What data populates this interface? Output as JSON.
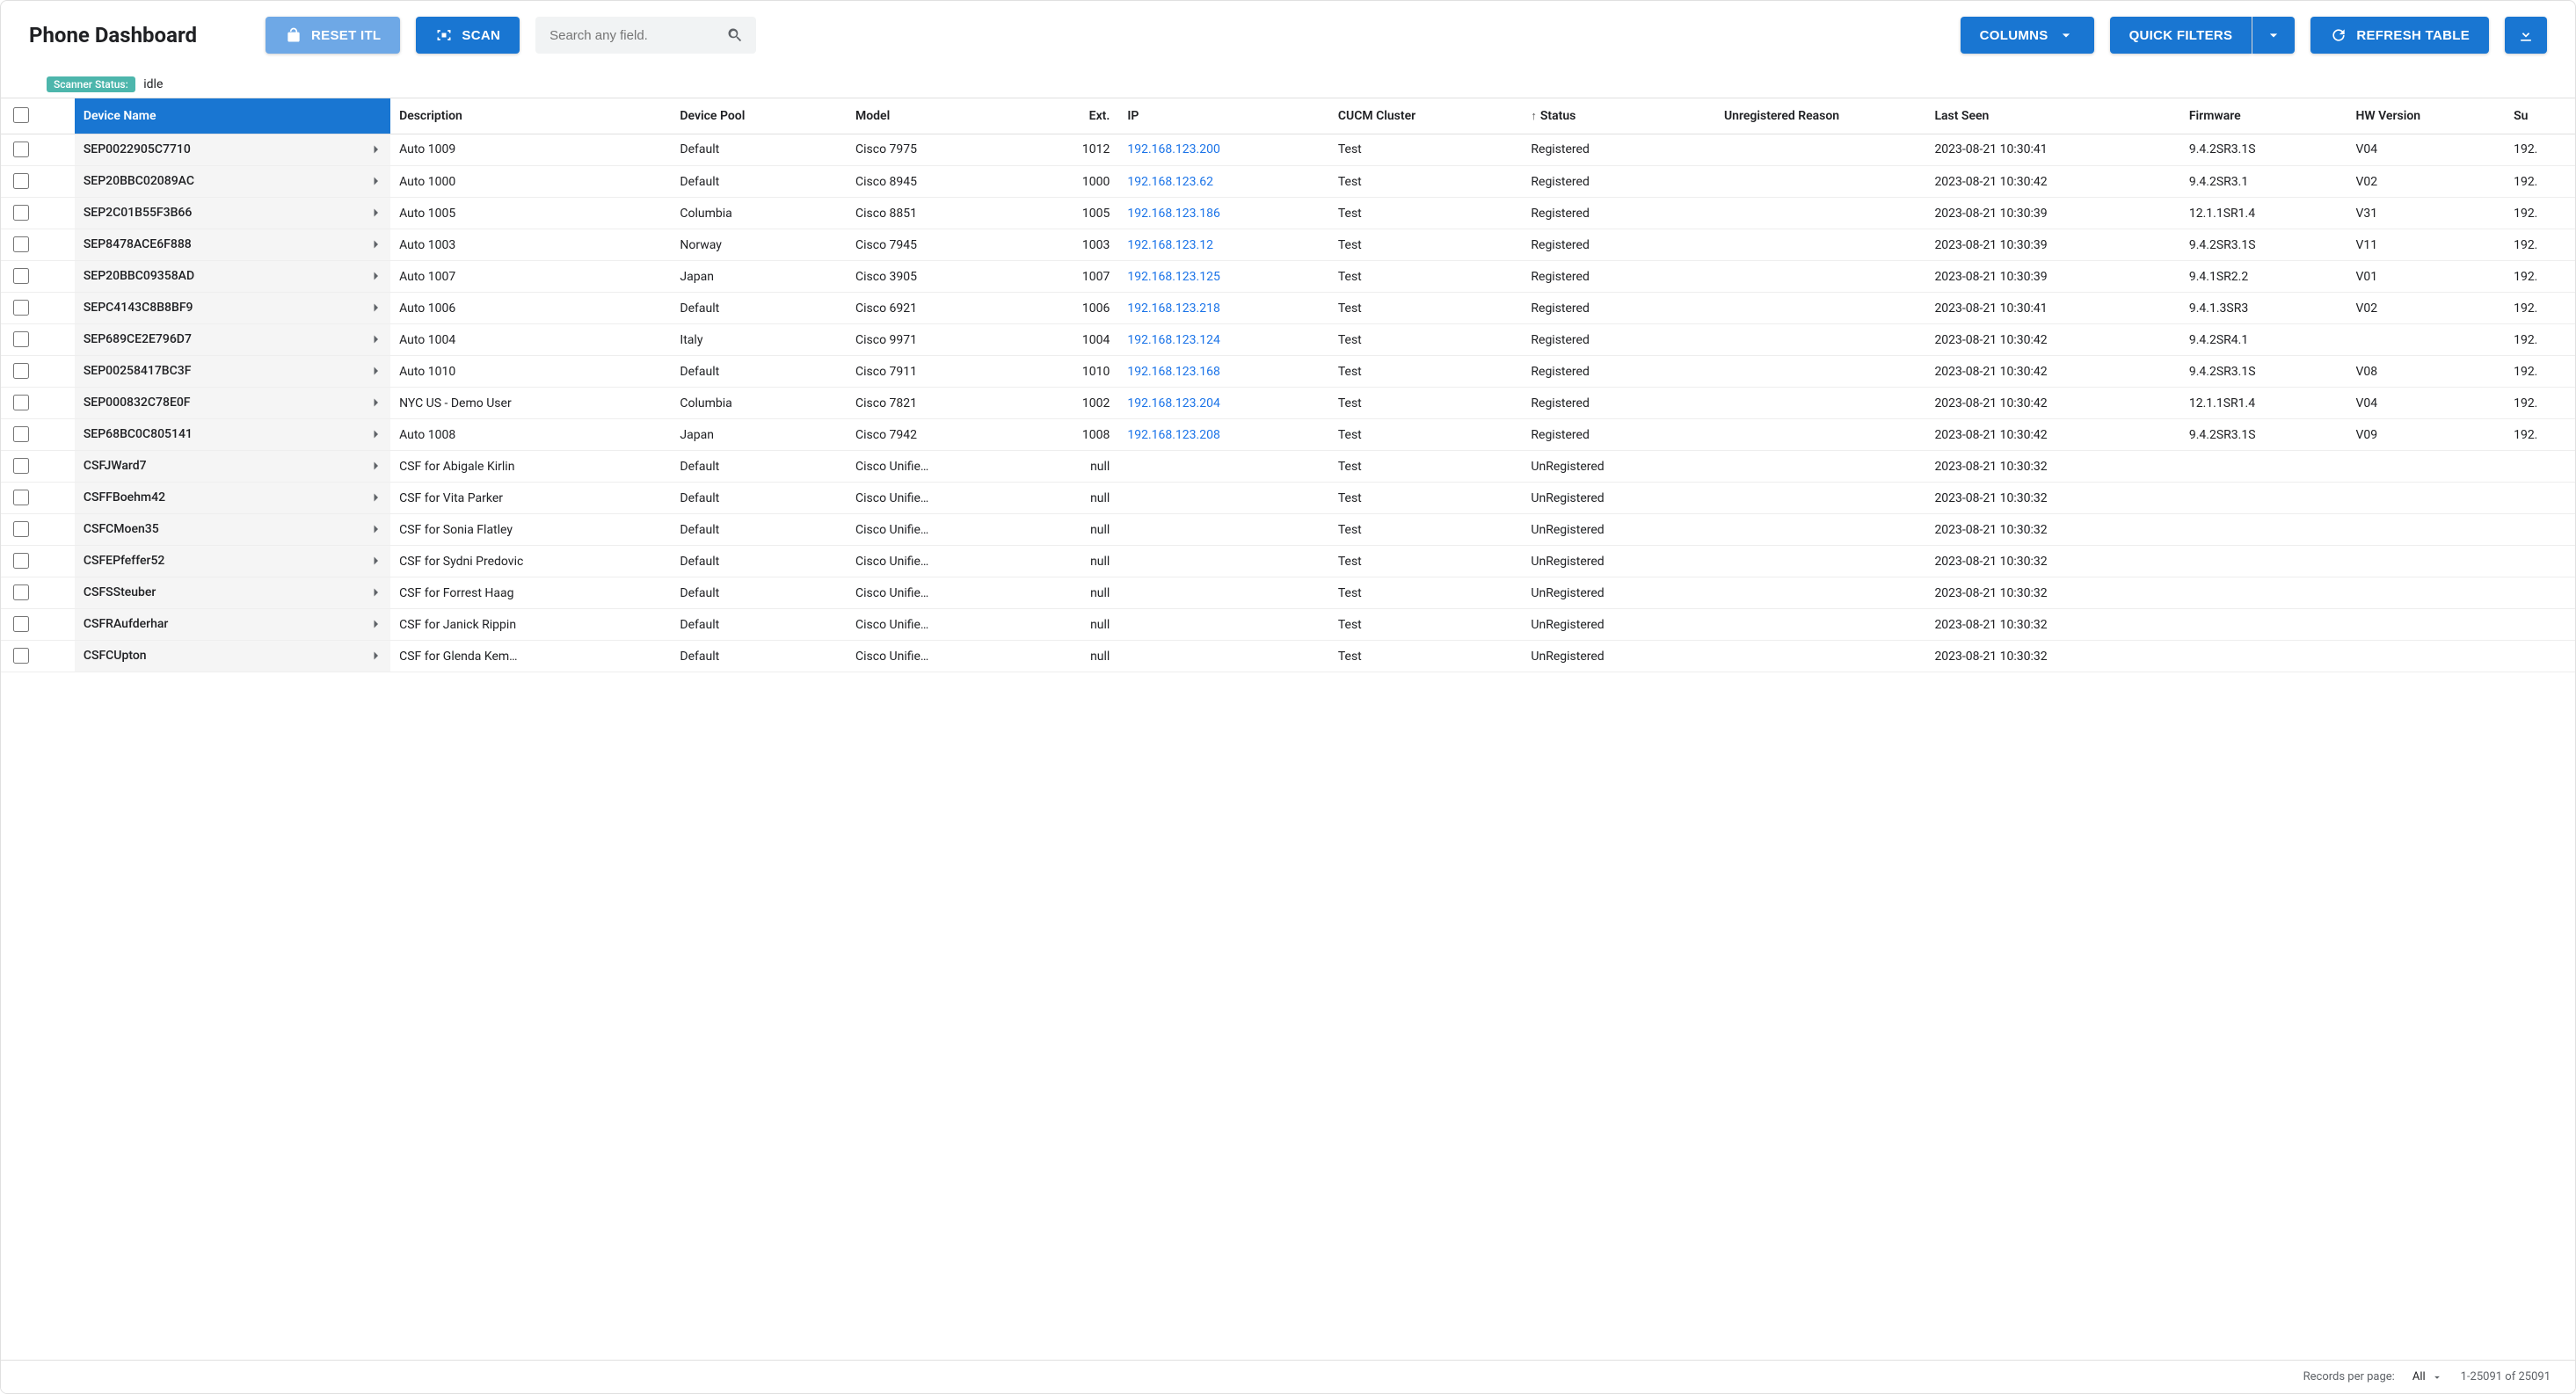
{
  "title": "Phone Dashboard",
  "header": {
    "reset_itl": "RESET ITL",
    "scan": "SCAN",
    "search_placeholder": "Search any field.",
    "columns": "COLUMNS",
    "quick_filters": "QUICK FILTERS",
    "refresh": "REFRESH TABLE"
  },
  "scanner": {
    "label": "Scanner Status:",
    "value": "idle"
  },
  "columns": {
    "device_name": "Device Name",
    "description": "Description",
    "device_pool": "Device Pool",
    "model": "Model",
    "ext": "Ext.",
    "ip": "IP",
    "cucm": "CUCM Cluster",
    "status": "Status",
    "unreg_reason": "Unregistered Reason",
    "last_seen": "Last Seen",
    "firmware": "Firmware",
    "hw_version": "HW Version",
    "sub": "Su"
  },
  "rows": [
    {
      "device": "SEP0022905C7710",
      "desc": "Auto 1009",
      "pool": "Default",
      "model": "Cisco 7975",
      "ext": "1012",
      "ip": "192.168.123.200",
      "cucm": "Test",
      "status": "Registered",
      "unreg": "",
      "seen": "2023-08-21 10:30:41",
      "fw": "9.4.2SR3.1S",
      "hw": "V04",
      "sub": "192."
    },
    {
      "device": "SEP20BBC02089AC",
      "desc": "Auto 1000",
      "pool": "Default",
      "model": "Cisco 8945",
      "ext": "1000",
      "ip": "192.168.123.62",
      "cucm": "Test",
      "status": "Registered",
      "unreg": "",
      "seen": "2023-08-21 10:30:42",
      "fw": "9.4.2SR3.1",
      "hw": "V02",
      "sub": "192."
    },
    {
      "device": "SEP2C01B55F3B66",
      "desc": "Auto 1005",
      "pool": "Columbia",
      "model": "Cisco 8851",
      "ext": "1005",
      "ip": "192.168.123.186",
      "cucm": "Test",
      "status": "Registered",
      "unreg": "",
      "seen": "2023-08-21 10:30:39",
      "fw": "12.1.1SR1.4",
      "hw": "V31",
      "sub": "192."
    },
    {
      "device": "SEP8478ACE6F888",
      "desc": "Auto 1003",
      "pool": "Norway",
      "model": "Cisco 7945",
      "ext": "1003",
      "ip": "192.168.123.12",
      "cucm": "Test",
      "status": "Registered",
      "unreg": "",
      "seen": "2023-08-21 10:30:39",
      "fw": "9.4.2SR3.1S",
      "hw": "V11",
      "sub": "192."
    },
    {
      "device": "SEP20BBC09358AD",
      "desc": "Auto 1007",
      "pool": "Japan",
      "model": "Cisco 3905",
      "ext": "1007",
      "ip": "192.168.123.125",
      "cucm": "Test",
      "status": "Registered",
      "unreg": "",
      "seen": "2023-08-21 10:30:39",
      "fw": "9.4.1SR2.2",
      "hw": "V01",
      "sub": "192."
    },
    {
      "device": "SEPC4143C8B8BF9",
      "desc": "Auto 1006",
      "pool": "Default",
      "model": "Cisco 6921",
      "ext": "1006",
      "ip": "192.168.123.218",
      "cucm": "Test",
      "status": "Registered",
      "unreg": "",
      "seen": "2023-08-21 10:30:41",
      "fw": "9.4.1.3SR3",
      "hw": "V02",
      "sub": "192."
    },
    {
      "device": "SEP689CE2E796D7",
      "desc": "Auto 1004",
      "pool": "Italy",
      "model": "Cisco 9971",
      "ext": "1004",
      "ip": "192.168.123.124",
      "cucm": "Test",
      "status": "Registered",
      "unreg": "",
      "seen": "2023-08-21 10:30:42",
      "fw": "9.4.2SR4.1",
      "hw": "",
      "sub": "192."
    },
    {
      "device": "SEP00258417BC3F",
      "desc": "Auto 1010",
      "pool": "Default",
      "model": "Cisco 7911",
      "ext": "1010",
      "ip": "192.168.123.168",
      "cucm": "Test",
      "status": "Registered",
      "unreg": "",
      "seen": "2023-08-21 10:30:42",
      "fw": "9.4.2SR3.1S",
      "hw": "V08",
      "sub": "192."
    },
    {
      "device": "SEP000832C78E0F",
      "desc": "NYC US - Demo User",
      "pool": "Columbia",
      "model": "Cisco 7821",
      "ext": "1002",
      "ip": "192.168.123.204",
      "cucm": "Test",
      "status": "Registered",
      "unreg": "",
      "seen": "2023-08-21 10:30:42",
      "fw": "12.1.1SR1.4",
      "hw": "V04",
      "sub": "192."
    },
    {
      "device": "SEP68BC0C805141",
      "desc": "Auto 1008",
      "pool": "Japan",
      "model": "Cisco 7942",
      "ext": "1008",
      "ip": "192.168.123.208",
      "cucm": "Test",
      "status": "Registered",
      "unreg": "",
      "seen": "2023-08-21 10:30:42",
      "fw": "9.4.2SR3.1S",
      "hw": "V09",
      "sub": "192."
    },
    {
      "device": "CSFJWard7",
      "desc": "CSF for Abigale Kirlin",
      "pool": "Default",
      "model": "Cisco Unifie…",
      "ext": "null",
      "ip": "",
      "cucm": "Test",
      "status": "UnRegistered",
      "unreg": "",
      "seen": "2023-08-21 10:30:32",
      "fw": "",
      "hw": "",
      "sub": ""
    },
    {
      "device": "CSFFBoehm42",
      "desc": "CSF for Vita Parker",
      "pool": "Default",
      "model": "Cisco Unifie…",
      "ext": "null",
      "ip": "",
      "cucm": "Test",
      "status": "UnRegistered",
      "unreg": "",
      "seen": "2023-08-21 10:30:32",
      "fw": "",
      "hw": "",
      "sub": ""
    },
    {
      "device": "CSFCMoen35",
      "desc": "CSF for Sonia Flatley",
      "pool": "Default",
      "model": "Cisco Unifie…",
      "ext": "null",
      "ip": "",
      "cucm": "Test",
      "status": "UnRegistered",
      "unreg": "",
      "seen": "2023-08-21 10:30:32",
      "fw": "",
      "hw": "",
      "sub": ""
    },
    {
      "device": "CSFEPfeffer52",
      "desc": "CSF for Sydni Predovic",
      "pool": "Default",
      "model": "Cisco Unifie…",
      "ext": "null",
      "ip": "",
      "cucm": "Test",
      "status": "UnRegistered",
      "unreg": "",
      "seen": "2023-08-21 10:30:32",
      "fw": "",
      "hw": "",
      "sub": ""
    },
    {
      "device": "CSFSSteuber",
      "desc": "CSF for Forrest Haag",
      "pool": "Default",
      "model": "Cisco Unifie…",
      "ext": "null",
      "ip": "",
      "cucm": "Test",
      "status": "UnRegistered",
      "unreg": "",
      "seen": "2023-08-21 10:30:32",
      "fw": "",
      "hw": "",
      "sub": ""
    },
    {
      "device": "CSFRAufderhar",
      "desc": "CSF for Janick Rippin",
      "pool": "Default",
      "model": "Cisco Unifie…",
      "ext": "null",
      "ip": "",
      "cucm": "Test",
      "status": "UnRegistered",
      "unreg": "",
      "seen": "2023-08-21 10:30:32",
      "fw": "",
      "hw": "",
      "sub": ""
    },
    {
      "device": "CSFCUpton",
      "desc": "CSF for Glenda Kem…",
      "pool": "Default",
      "model": "Cisco Unifie…",
      "ext": "null",
      "ip": "",
      "cucm": "Test",
      "status": "UnRegistered",
      "unreg": "",
      "seen": "2023-08-21 10:30:32",
      "fw": "",
      "hw": "",
      "sub": ""
    }
  ],
  "footer": {
    "rpp_label": "Records per page:",
    "rpp_value": "All",
    "range": "1-25091 of 25091"
  }
}
